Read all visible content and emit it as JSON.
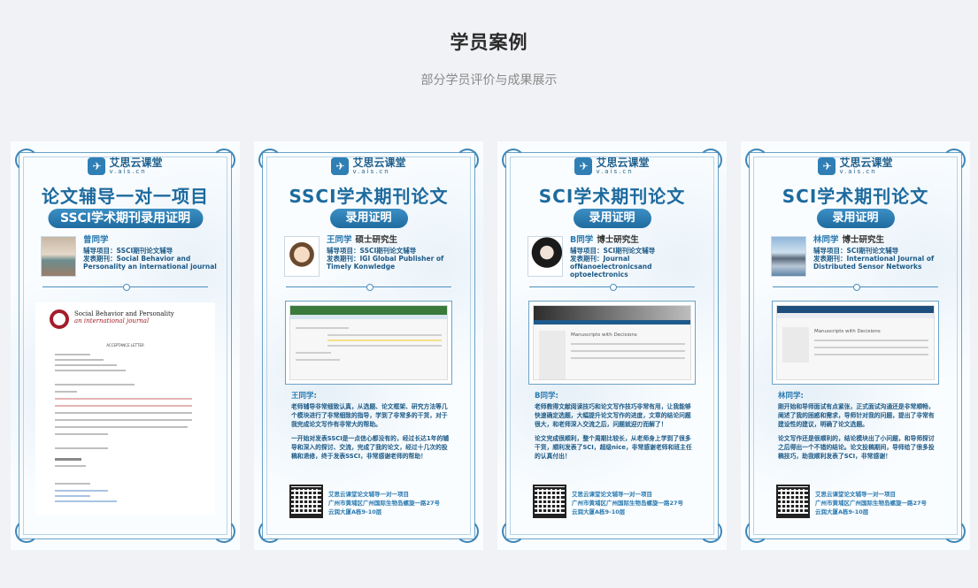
{
  "header": {
    "title": "学员案例",
    "subtitle": "部分学员评价与成果展示"
  },
  "brand": {
    "name": "艾思云课堂",
    "url": "v.ais.cn"
  },
  "footer": {
    "line1": "艾思云课堂论文辅导一对一项目",
    "line2": "广州市黄埔区广州国际生物岛螺旋一路27号",
    "line3": "云润大厦A栋9-10层"
  },
  "cards": [
    {
      "big_title": "论文辅导一对一项目",
      "pill": "SSCI学术期刊录用证明",
      "student_name": "曾同学",
      "degree": "",
      "project_line": "辅导项目：SSCI期刊论文辅导",
      "journal_line": "发表期刊：Social Behavior and Personality an international journal",
      "letter": {
        "journal_name": "Social Behavior and Personality",
        "journal_sub": "an international journal",
        "heading": "ACCEPTANCE LETTER"
      }
    },
    {
      "big_title": "SSCI学术期刊论文",
      "pill": "录用证明",
      "student_name": "王同学",
      "degree": "硕士研究生",
      "project_line": "辅导项目：SSCI期刊论文辅导",
      "journal_line": "发表期刊：IGI Global Publisher of Timely Konwledge",
      "review_name": "王同学:",
      "review_p1": "老师辅导非常细致认真，从选题、论文框架、研究方法等几个模块进行了非常细致的指导，学到了非常多的干货，对于我完成论文写作有非常大的帮助。",
      "review_p2": "一开始对发表SSCI是一点信心都没有的，经过长达1年的辅导和深入的探讨、交流，完成了我的论文，经过十几次的投稿和退修，终于发表SSCI，非常感谢老师的帮助！"
    },
    {
      "big_title": "SCI学术期刊论文",
      "pill": "录用证明",
      "student_name": "B同学",
      "degree": "博士研究生",
      "project_line": "辅导项目：SCI期刊论文辅导",
      "journal_line": "发表期刊：Journal ofNanoelectronicsand optoelectronics",
      "shot_title": "Manuscripts with Decisions",
      "review_name": "B同学:",
      "review_p1": "老师教得文献阅读技巧和论文写作技巧非常有用，让我能够快速确定选题，大幅提升论文写作的进度，文章的结论问题很大，和老师深入交流之后，问题就迎刃而解了！",
      "review_p2": "论文完成很顺利，整个周期比较长，从老师身上学到了很多干货，顺利发表了SCI，超级nice，非常感谢老师和班主任的认真付出！"
    },
    {
      "big_title": "SCI学术期刊论文",
      "pill": "录用证明",
      "student_name": "林同学",
      "degree": "博士研究生",
      "project_line": "辅导项目：SCI期刊论文辅导",
      "journal_line": "发表期刊：International Journal of Distributed Sensor Networks",
      "shot_title": "Manuscripts with Decisions",
      "review_name": "林同学:",
      "review_p1": "刚开始和导师面试有点紧张，正式面试沟通还是非常顺畅，阐述了我的困惑和需求，导师针对我的问题，提出了非常有建设性的建议，明确了论文选题。",
      "review_p2": "论文写作还是很顺利的，结论模块出了小问题，和导师探讨之后得出一个不错的结论。论文投稿期间，导师给了很多投稿技巧，助我顺利发表了SCI，非常感谢！"
    }
  ]
}
